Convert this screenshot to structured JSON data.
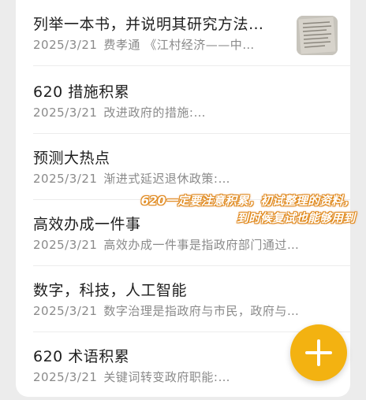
{
  "notes": [
    {
      "title": "列举一本书，并说明其研究方法…",
      "date": "2025/3/21",
      "preview": "费孝通 《江村经济——中…",
      "has_thumbnail": true
    },
    {
      "title": "620 措施积累",
      "date": "2025/3/21",
      "preview": "改进政府的措施:…"
    },
    {
      "title": "预测大热点",
      "date": "2025/3/21",
      "preview": "渐进式延迟退休政策:…"
    },
    {
      "title": "高效办成一件事",
      "date": "2025/3/21",
      "preview": "高效办成一件事是指政府部门通过…"
    },
    {
      "title": "数字，科技，人工智能",
      "date": "2025/3/21",
      "preview": "数字治理是指政府与市民，政府与…"
    },
    {
      "title": "620 术语积累",
      "date": "2025/3/21",
      "preview": "关键词转变政府职能:…"
    }
  ],
  "annotation": {
    "line1": "620一定要注意积累，初试整理的资料，",
    "line2": "到时候复试也能够用到"
  },
  "fab": {
    "icon": "plus-icon"
  },
  "colors": {
    "accent": "#f3b211",
    "annotation_stroke": "#e08a1e"
  }
}
